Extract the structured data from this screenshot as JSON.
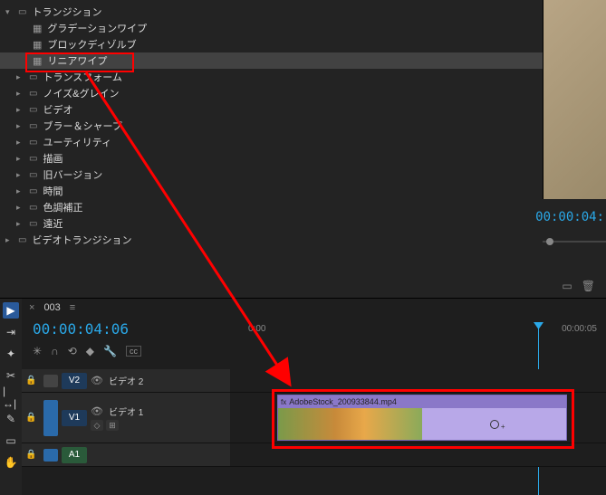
{
  "effects_panel": {
    "root": {
      "label": "トランジション"
    },
    "items": [
      {
        "label": "グラデーションワイプ",
        "type": "effect",
        "badge": true
      },
      {
        "label": "ブロックディゾルブ",
        "type": "effect",
        "badge": true
      },
      {
        "label": "リニアワイプ",
        "type": "effect",
        "badge": true,
        "selected": true
      },
      {
        "label": "トランスフォーム",
        "type": "folder"
      },
      {
        "label": "ノイズ&グレイン",
        "type": "folder"
      },
      {
        "label": "ビデオ",
        "type": "folder"
      },
      {
        "label": "ブラー＆シャープ",
        "type": "folder"
      },
      {
        "label": "ユーティリティ",
        "type": "folder"
      },
      {
        "label": "描画",
        "type": "folder"
      },
      {
        "label": "旧バージョン",
        "type": "folder"
      },
      {
        "label": "時間",
        "type": "folder"
      },
      {
        "label": "色調補正",
        "type": "folder"
      },
      {
        "label": "遠近",
        "type": "folder"
      }
    ],
    "bottom_item": {
      "label": "ビデオトランジション"
    }
  },
  "preview": {
    "timecode": "00:00:04:"
  },
  "sequence": {
    "tab_name": "003",
    "timecode": "00:00:04:06",
    "ruler": {
      "start": "0:00",
      "end": "00:00:05"
    },
    "tracks": {
      "v2": {
        "tag": "V2",
        "name": "ビデオ 2"
      },
      "v1": {
        "tag": "V1",
        "name": "ビデオ 1"
      },
      "a1": {
        "tag": "A1"
      }
    },
    "clip": {
      "name": "AdobeStock_200933844.mp4"
    }
  },
  "icons": {
    "folder": "▭",
    "trash": "🗑",
    "new": "▭"
  }
}
